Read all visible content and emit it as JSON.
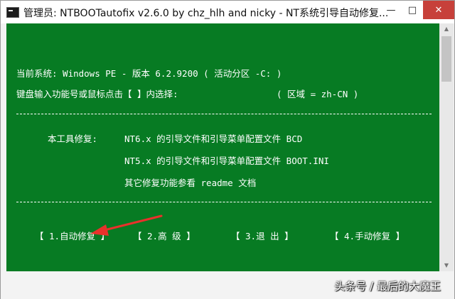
{
  "window": {
    "title": "管理员:  NTBOOTautofix v2.6.0 by chz_hlh and nicky - NT系统引导自动修复...",
    "minimize": "—",
    "maximize": "□",
    "close": "✕"
  },
  "console": {
    "system_line": "当前系统: Windows PE - 版本 6.2.9200   ( 活动分区 -C: )",
    "prompt_line": "键盘输入功能号或鼠标点击【 】内选择:",
    "region_line": "( 区域 = zh-CN )",
    "repair_label": "本工具修复:",
    "nt6_line": "NT6.x 的引导文件和引导菜单配置文件 BCD",
    "nt5_line": "NT5.x 的引导文件和引导菜单配置文件 BOOT.INI",
    "other_line": "其它修复功能参看 readme 文档"
  },
  "menu": {
    "auto_repair": "【 1.自动修复 】",
    "advanced": "【  2.高  级  】",
    "exit": "【  3.退  出  】",
    "manual_repair": "【 4.手动修复 】"
  },
  "colors": {
    "console_bg": "#077b23",
    "text": "#ffffff",
    "arrow": "#e8312b",
    "close_button": "#c7403a"
  },
  "watermark": "头条号 / 最后的大魔王"
}
